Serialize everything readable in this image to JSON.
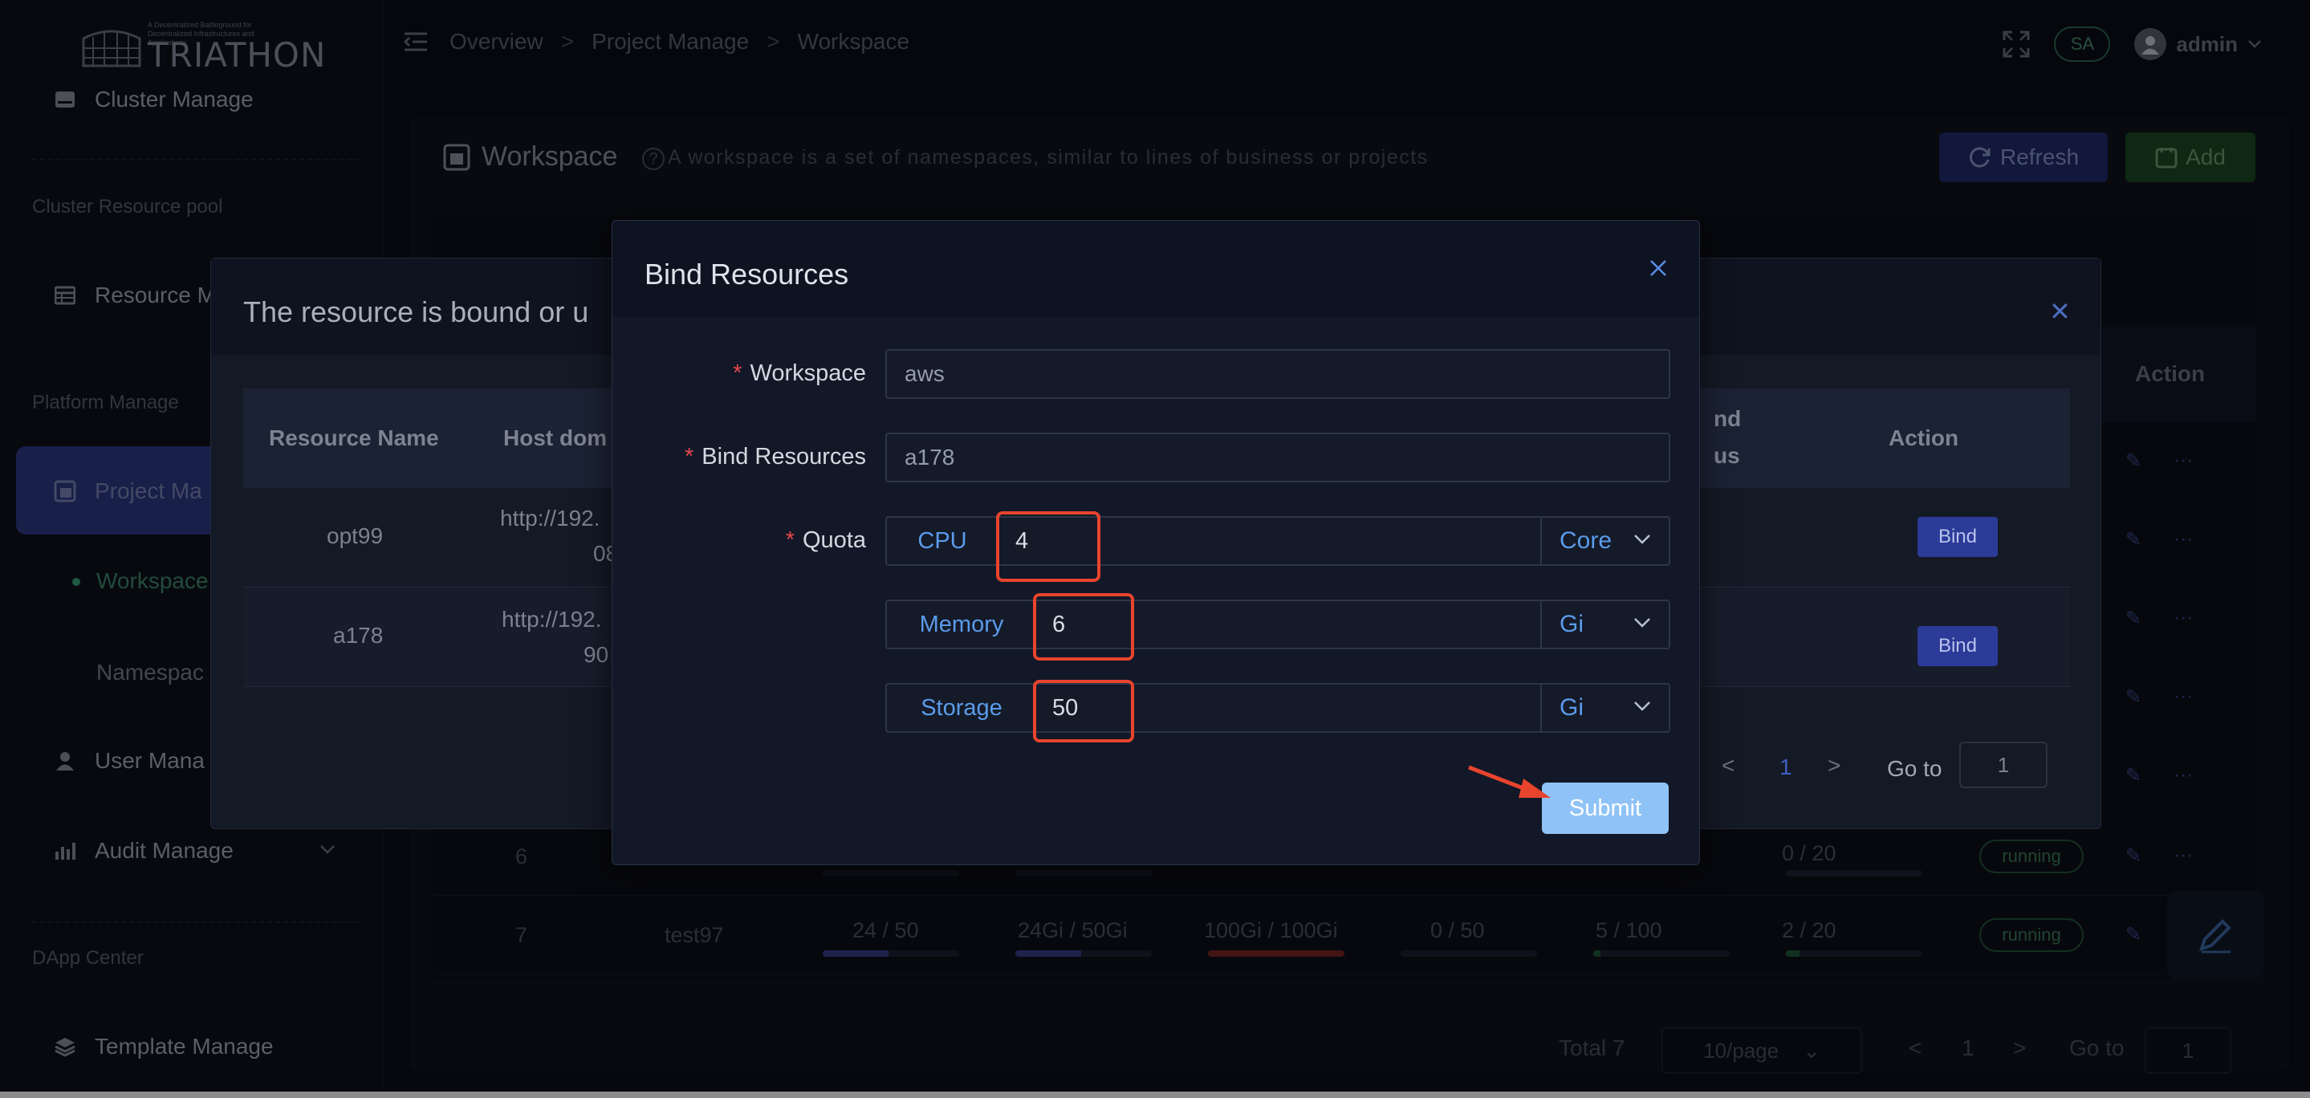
{
  "brand": {
    "name": "TRIATHON",
    "tagline": "A Decentralized Battleground for Decentralized Infrastructures and Applications"
  },
  "sidebar": {
    "items": [
      {
        "label": "Cluster Manage",
        "icon": "server-icon"
      },
      {
        "label": "Resource M",
        "icon": "table-icon"
      },
      {
        "label": "Project Ma",
        "icon": "project-icon"
      },
      {
        "label": "User Mana",
        "icon": "user-icon"
      },
      {
        "label": "Audit Manage",
        "icon": "bar-chart-icon"
      },
      {
        "label": "Template Manage",
        "icon": "layers-icon"
      }
    ],
    "sections": [
      "Cluster Resource pool",
      "Platform Manage",
      "DApp Center"
    ],
    "subitems": [
      "Workspace",
      "Namespac"
    ]
  },
  "header": {
    "breadcrumbs": [
      "Overview",
      "Project Manage",
      "Workspace"
    ],
    "badge": "SA",
    "user": "admin"
  },
  "page": {
    "title": "Workspace",
    "description": "A workspace is a set of namespaces, similar to lines of business or projects",
    "refresh_label": "Refresh",
    "add_label": "Add",
    "action_header": "Action",
    "rows": [
      {
        "index": "6",
        "name": "",
        "cpu": "",
        "mem": "",
        "storage": "",
        "c4": "",
        "c5": "",
        "c6": "0 / 20",
        "status": "running"
      },
      {
        "index": "7",
        "name": "test97",
        "cpu": "24 / 50",
        "mem": "24Gi / 50Gi",
        "storage": "100Gi / 100Gi",
        "c4": "0 / 50",
        "c5": "5 / 100",
        "c6": "2 / 20",
        "status": "running"
      }
    ],
    "bar_fill": {
      "cpu": 0.48,
      "mem": 0.48,
      "storage": 1.0,
      "c4": 0.0,
      "c5": 0.05,
      "c6": 0.1
    },
    "pager": {
      "total": "Total 7",
      "page_size": "10/page",
      "page": "1",
      "goto_label": "Go to",
      "goto_value": "1"
    }
  },
  "back_modal": {
    "title": "The resource is bound or u",
    "headers": {
      "name": "Resource Name",
      "host": "Host dom",
      "bind_status_1": "nd",
      "bind_status_2": "us",
      "action": "Action"
    },
    "rows": [
      {
        "name": "opt99",
        "host_1": "http://192.",
        "host_2": "08",
        "action": "Bind"
      },
      {
        "name": "a178",
        "host_1": "http://192.",
        "host_2": "90",
        "action": "Bind"
      }
    ],
    "pager": {
      "page": "1",
      "goto_label": "Go to",
      "goto_value": "1"
    }
  },
  "modal": {
    "title": "Bind Resources",
    "workspace_label": "Workspace",
    "workspace_value": "aws",
    "bind_label": "Bind Resources",
    "bind_value": "a178",
    "quota_label": "Quota",
    "quota": [
      {
        "name": "CPU",
        "value": "4",
        "unit": "Core"
      },
      {
        "name": "Memory",
        "value": "6",
        "unit": "Gi"
      },
      {
        "name": "Storage",
        "value": "50",
        "unit": "Gi"
      }
    ],
    "submit_label": "Submit"
  },
  "colors": {
    "accent": "#5b9bea",
    "highlight": "#e8442e",
    "submit": "#8fc3f7",
    "bind_button": "#2c3b98",
    "running": "#3d7d57"
  }
}
